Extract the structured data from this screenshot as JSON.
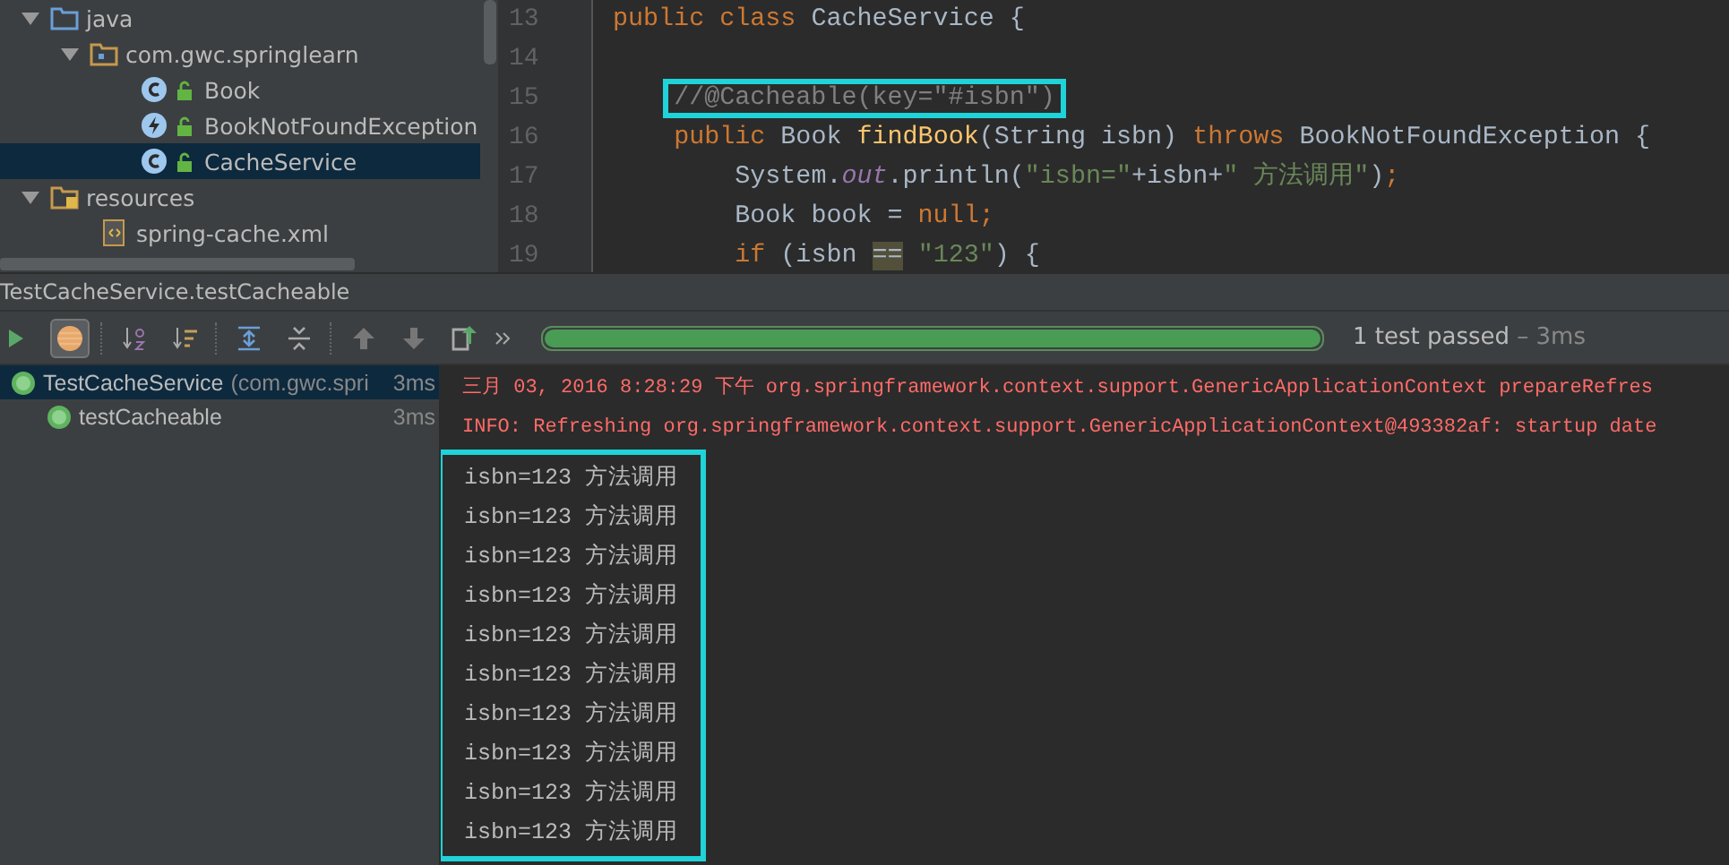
{
  "project_tree": [
    {
      "label": "java",
      "kind": "source-folder",
      "expanded": true,
      "selected": false,
      "children": [
        {
          "label": "com.gwc.springlearn",
          "kind": "package",
          "expanded": true,
          "selected": false,
          "children": [
            {
              "label": "Book",
              "kind": "class",
              "selected": false
            },
            {
              "label": "BookNotFoundException",
              "kind": "exception",
              "selected": false
            },
            {
              "label": "CacheService",
              "kind": "class",
              "selected": true
            }
          ]
        }
      ]
    },
    {
      "label": "resources",
      "kind": "resource-folder",
      "expanded": true,
      "selected": false,
      "children": [
        {
          "label": "spring-cache.xml",
          "kind": "xml",
          "selected": false
        }
      ]
    }
  ],
  "editor": {
    "lines": [
      {
        "number": "13",
        "tokens": [
          {
            "text": "public class ",
            "kind": "keyword"
          },
          {
            "text": "CacheService {",
            "kind": "plain"
          }
        ]
      },
      {
        "number": "14"
      },
      {
        "number": "15",
        "tokens": [
          {
            "text": "    //@Cacheable(key=\"#isbn\")",
            "kind": "comment",
            "boxed": true
          }
        ]
      },
      {
        "number": "16",
        "tokens": [
          {
            "text": "    public ",
            "kind": "keyword"
          },
          {
            "text": "Book ",
            "kind": "plain"
          },
          {
            "text": "findBook",
            "kind": "method"
          },
          {
            "text": "(String isbn) ",
            "kind": "plain"
          },
          {
            "text": "throws ",
            "kind": "keyword"
          },
          {
            "text": "BookNotFoundException {",
            "kind": "plain"
          }
        ]
      },
      {
        "number": "17",
        "tokens": [
          {
            "text": "        System.",
            "kind": "plain"
          },
          {
            "text": "out",
            "kind": "field"
          },
          {
            "text": ".println(",
            "kind": "plain"
          },
          {
            "text": "\"isbn=\"",
            "kind": "string"
          },
          {
            "text": "+isbn+",
            "kind": "plain"
          },
          {
            "text": "\" 方法调用\"",
            "kind": "string"
          },
          {
            "text": ")",
            "kind": "plain"
          },
          {
            "text": ";",
            "kind": "keyword"
          }
        ]
      },
      {
        "number": "18",
        "tokens": [
          {
            "text": "        Book book = ",
            "kind": "plain"
          },
          {
            "text": "null",
            "kind": "keyword"
          },
          {
            "text": ";",
            "kind": "keyword"
          }
        ]
      },
      {
        "number": "19",
        "tokens": [
          {
            "text": "        if ",
            "kind": "keyword"
          },
          {
            "text": "(isbn ",
            "kind": "plain"
          },
          {
            "text": "==",
            "kind": "match"
          },
          {
            "text": " \"123\"",
            "kind": "string"
          },
          {
            "text": ") {",
            "kind": "plain"
          }
        ]
      }
    ]
  },
  "run_panel": {
    "title": "TestCacheService.testCacheable",
    "progress": {
      "level": 1,
      "summary": "1 test passed",
      "duration": " – 3ms"
    },
    "tests": [
      {
        "label": "TestCacheService",
        "detail": "(com.gwc.spri",
        "time": "3ms",
        "selected": true,
        "children": [
          {
            "label": "testCacheable",
            "time": "3ms",
            "selected": false
          }
        ]
      }
    ],
    "console": [
      {
        "kind": "log",
        "text": "三月 03, 2016 8:28:29 下午 org.springframework.context.support.GenericApplicationContext prepareRefres"
      },
      {
        "kind": "log",
        "text": "INFO: Refreshing org.springframework.context.support.GenericApplicationContext@493382af: startup date"
      }
    ],
    "output_boxed": true,
    "output": [
      "isbn=123 方法调用",
      "isbn=123 方法调用",
      "isbn=123 方法调用",
      "isbn=123 方法调用",
      "isbn=123 方法调用",
      "isbn=123 方法调用",
      "isbn=123 方法调用",
      "isbn=123 方法调用",
      "isbn=123 方法调用",
      "isbn=123 方法调用"
    ]
  }
}
